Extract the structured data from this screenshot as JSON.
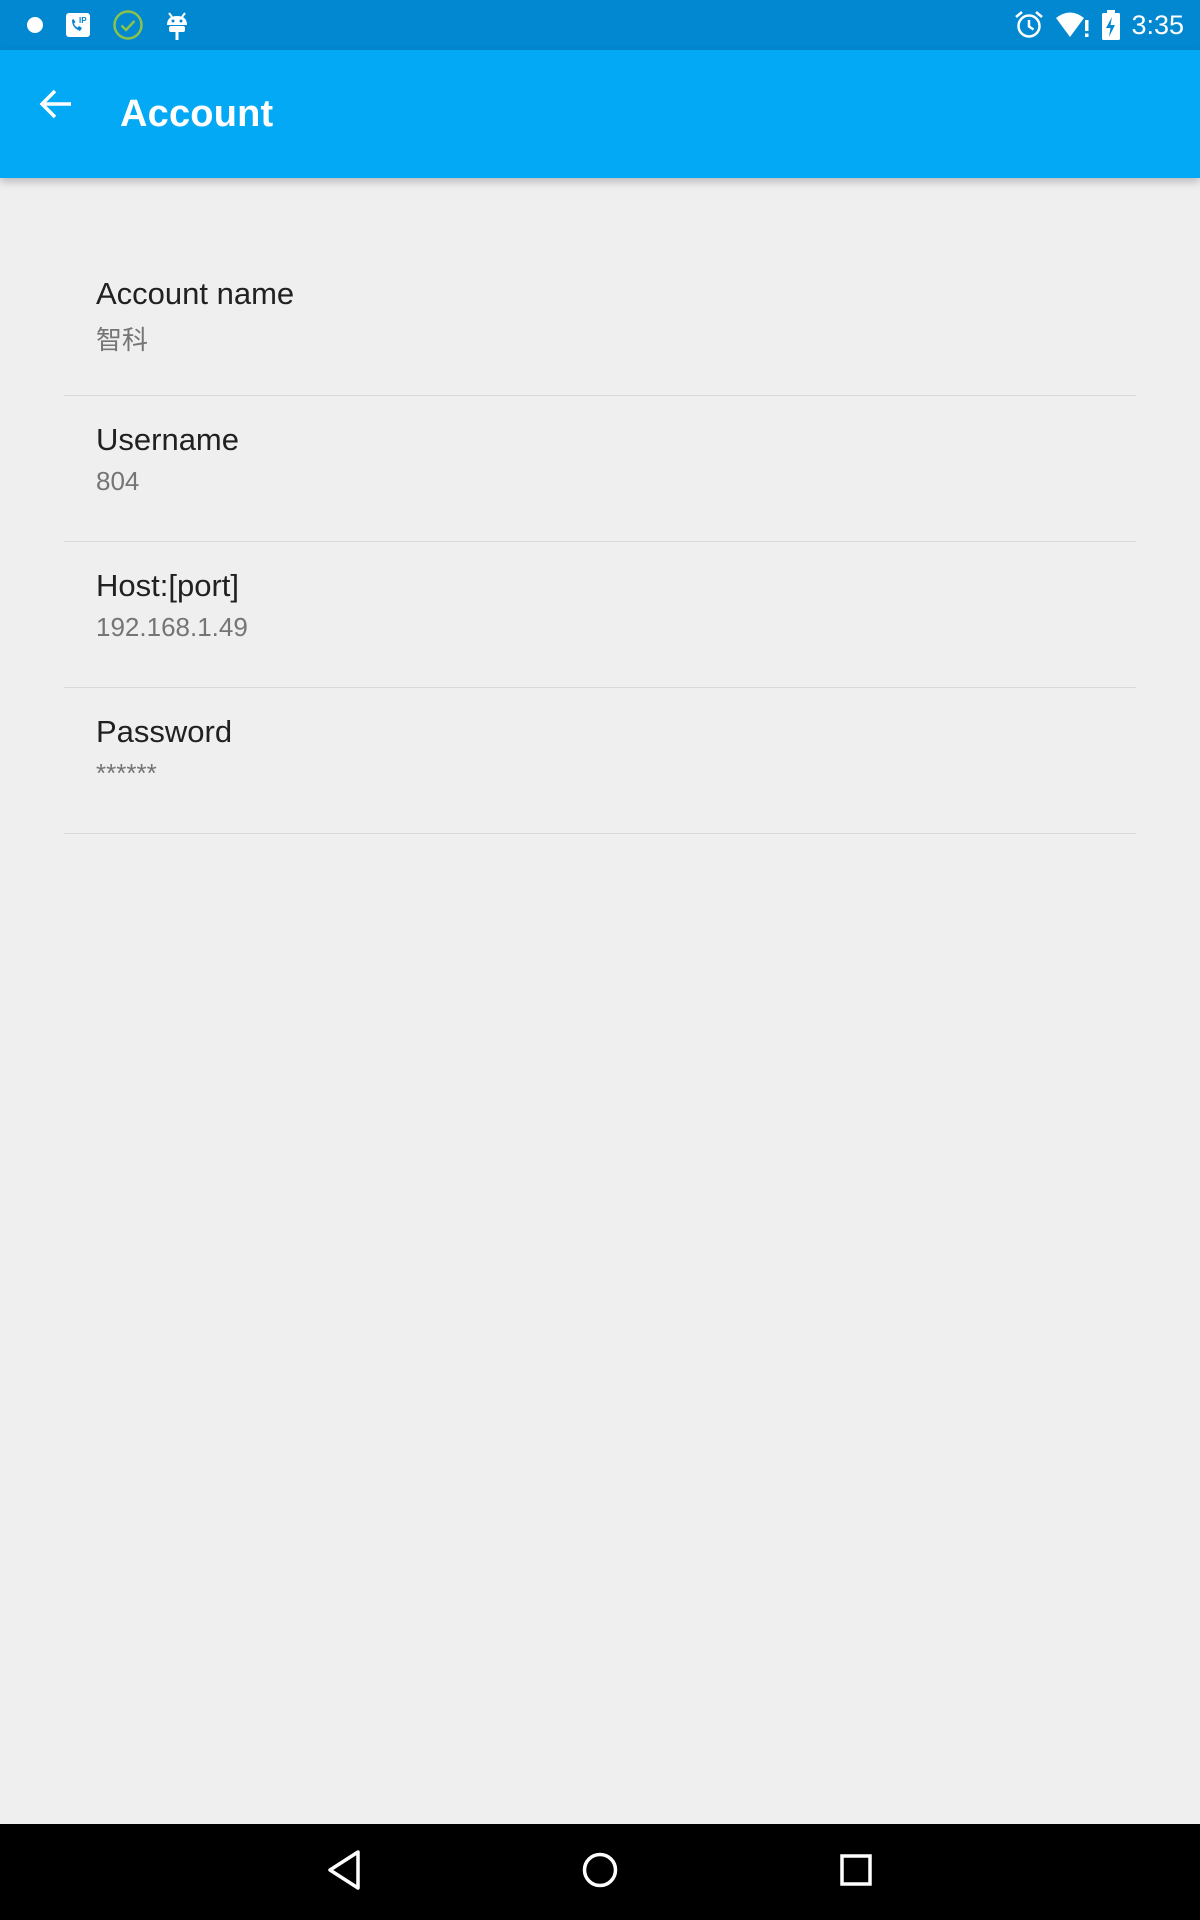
{
  "status_bar": {
    "time": "3:35",
    "left_icons": [
      "notification-dot-icon",
      "sip-phone-icon",
      "check-circle-icon",
      "android-debug-icon"
    ],
    "right_icons": [
      "alarm-icon",
      "wifi-alert-icon",
      "battery-charging-icon"
    ],
    "check_icon_color": "#8bc34a"
  },
  "app_bar": {
    "title": "Account",
    "back_icon": "arrow-back-icon",
    "color": "#03a9f4",
    "status_color": "#0288d1"
  },
  "preferences": [
    {
      "title": "Account name",
      "summary": "智科"
    },
    {
      "title": "Username",
      "summary": "804"
    },
    {
      "title": "Host:[port]",
      "summary": "192.168.1.49"
    },
    {
      "title": "Password",
      "summary": "******"
    }
  ],
  "nav_bar": {
    "icons": [
      "back-triangle-icon",
      "home-circle-icon",
      "recents-square-icon"
    ]
  }
}
